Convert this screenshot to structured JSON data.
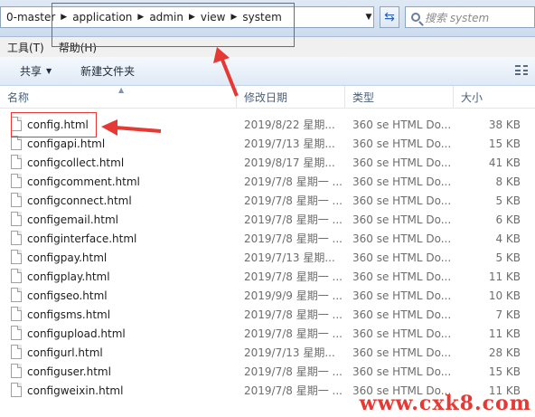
{
  "address": {
    "crumbs": [
      "0-master",
      "application",
      "admin",
      "view",
      "system"
    ],
    "search_placeholder": "搜索 system"
  },
  "menubar": {
    "tools": "工具(T)",
    "help": "帮助(H)"
  },
  "toolbar": {
    "share": "共享",
    "new_folder": "新建文件夹"
  },
  "columns": {
    "name": "名称",
    "date": "修改日期",
    "type": "类型",
    "size": "大小"
  },
  "files": [
    {
      "name": "config.html",
      "date": "2019/8/22 星期...",
      "type": "360 se HTML Do...",
      "size": "38 KB"
    },
    {
      "name": "configapi.html",
      "date": "2019/7/13 星期...",
      "type": "360 se HTML Do...",
      "size": "15 KB"
    },
    {
      "name": "configcollect.html",
      "date": "2019/8/17 星期...",
      "type": "360 se HTML Do...",
      "size": "41 KB"
    },
    {
      "name": "configcomment.html",
      "date": "2019/7/8 星期一 ...",
      "type": "360 se HTML Do...",
      "size": "8 KB"
    },
    {
      "name": "configconnect.html",
      "date": "2019/7/8 星期一 ...",
      "type": "360 se HTML Do...",
      "size": "5 KB"
    },
    {
      "name": "configemail.html",
      "date": "2019/7/8 星期一 ...",
      "type": "360 se HTML Do...",
      "size": "6 KB"
    },
    {
      "name": "configinterface.html",
      "date": "2019/7/8 星期一 ...",
      "type": "360 se HTML Do...",
      "size": "4 KB"
    },
    {
      "name": "configpay.html",
      "date": "2019/7/13 星期...",
      "type": "360 se HTML Do...",
      "size": "5 KB"
    },
    {
      "name": "configplay.html",
      "date": "2019/7/8 星期一 ...",
      "type": "360 se HTML Do...",
      "size": "11 KB"
    },
    {
      "name": "configseo.html",
      "date": "2019/9/9 星期一 ...",
      "type": "360 se HTML Do...",
      "size": "10 KB"
    },
    {
      "name": "configsms.html",
      "date": "2019/7/8 星期一 ...",
      "type": "360 se HTML Do...",
      "size": "7 KB"
    },
    {
      "name": "configupload.html",
      "date": "2019/7/8 星期一 ...",
      "type": "360 se HTML Do...",
      "size": "11 KB"
    },
    {
      "name": "configurl.html",
      "date": "2019/7/13 星期...",
      "type": "360 se HTML Do...",
      "size": "28 KB"
    },
    {
      "name": "configuser.html",
      "date": "2019/7/8 星期一 ...",
      "type": "360 se HTML Do...",
      "size": "15 KB"
    },
    {
      "name": "configweixin.html",
      "date": "2019/7/8 星期一 ...",
      "type": "360 se HTML Do...",
      "size": "11 KB"
    }
  ],
  "watermark": "www.cxk8.com",
  "annotation_color": "#e53935"
}
